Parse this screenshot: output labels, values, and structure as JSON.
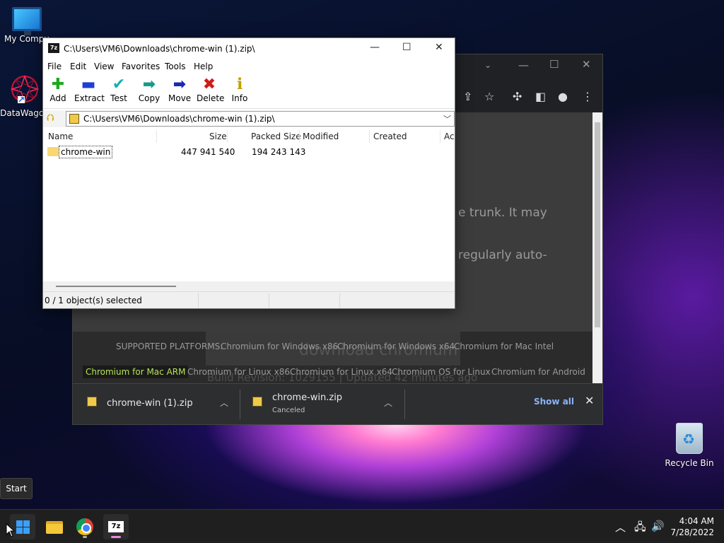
{
  "desktop": {
    "icons": [
      {
        "label": "My Compu"
      },
      {
        "label": "DataWagon"
      },
      {
        "label": "Recycle Bin"
      }
    ]
  },
  "chrome": {
    "body_lines": [
      "e trunk. It may",
      "regularly auto-"
    ],
    "ghost_title": "download chromium",
    "ghost_build": "Build Revision: 1029155 | Updated 42 minutes ago",
    "platforms_label": "SUPPORTED PLATFORMS:",
    "platforms_row1": [
      "Chromium for Windows x86",
      "Chromium for Windows x64",
      "Chromium for Mac Intel"
    ],
    "platforms_row2": [
      "Chromium for Mac ARM",
      "Chromium for Linux x86",
      "Chromium for Linux x64",
      "Chromium OS for Linux",
      "Chromium for Android"
    ],
    "downloads": [
      {
        "name": "chrome-win (1).zip",
        "status": ""
      },
      {
        "name": "chrome-win.zip",
        "status": "Canceled"
      }
    ],
    "show_all": "Show all",
    "close_glyph": "✕"
  },
  "zip": {
    "app_icon": "7z",
    "title": "C:\\Users\\VM6\\Downloads\\chrome-win (1).zip\\",
    "menu": [
      "File",
      "Edit",
      "View",
      "Favorites",
      "Tools",
      "Help"
    ],
    "toolbar": [
      {
        "label": "Add",
        "glyph": "✚",
        "color": "#1fa81f"
      },
      {
        "label": "Extract",
        "glyph": "▬",
        "color": "#1f3fd0"
      },
      {
        "label": "Test",
        "glyph": "✔",
        "color": "#19b0b0"
      },
      {
        "label": "Copy",
        "glyph": "➡",
        "color": "#1a9a8a"
      },
      {
        "label": "Move",
        "glyph": "➡",
        "color": "#1a2ab0"
      },
      {
        "label": "Delete",
        "glyph": "✖",
        "color": "#d01a1a"
      },
      {
        "label": "Info",
        "glyph": "ℹ",
        "color": "#c0a000"
      }
    ],
    "address": "C:\\Users\\VM6\\Downloads\\chrome-win (1).zip\\",
    "columns": [
      "Name",
      "Size",
      "Packed Size",
      "Modified",
      "Created",
      "Ac"
    ],
    "rows": [
      {
        "name": "chrome-win",
        "size": "447 941 540",
        "packed": "194 243 143"
      }
    ],
    "status": "0 / 1 object(s) selected"
  },
  "taskbar": {
    "start_tooltip": "Start",
    "time": "4:04 AM",
    "date": "7/28/2022",
    "sevenzip_label": "7z"
  }
}
